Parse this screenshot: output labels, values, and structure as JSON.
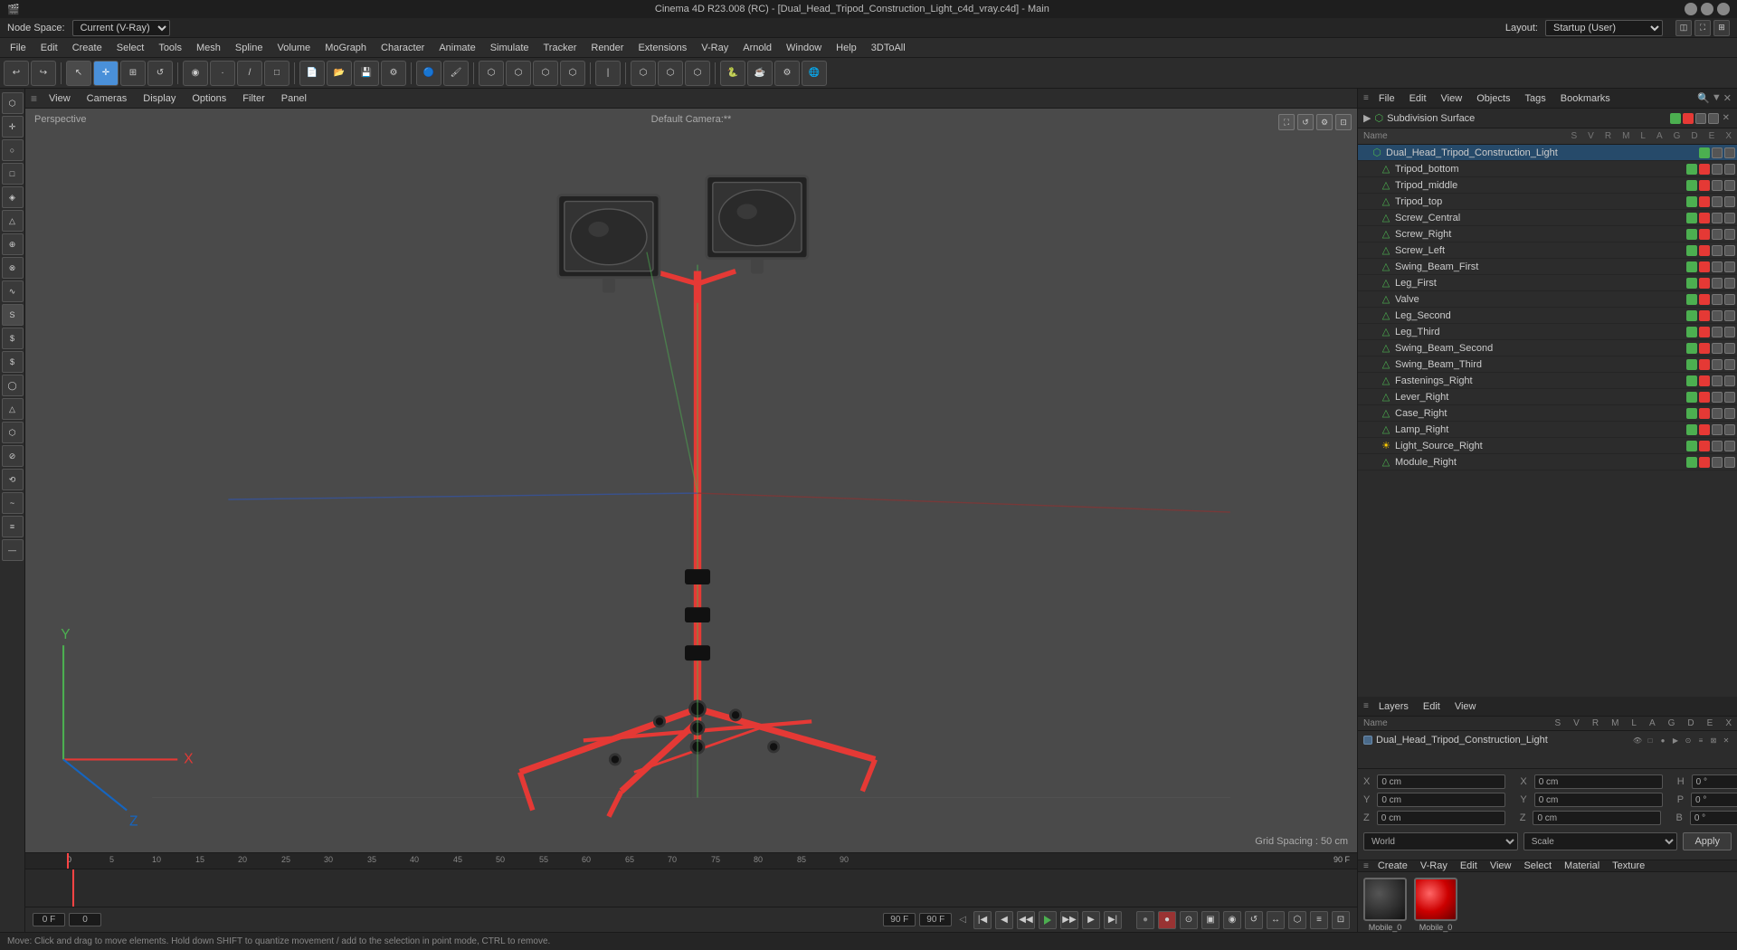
{
  "window": {
    "title": "Cinema 4D R23.008 (RC) - [Dual_Head_Tripod_Construction_Light_c4d_vray.c4d] - Main"
  },
  "menubar": {
    "items": [
      "File",
      "Edit",
      "Create",
      "Select",
      "Tools",
      "Mesh",
      "Spline",
      "Volume",
      "MoGraph",
      "Character",
      "Animate",
      "Simulate",
      "Tracker",
      "Render",
      "Extensions",
      "V-Ray",
      "Arnold",
      "Window",
      "Help",
      "3DToAll"
    ]
  },
  "toolbar": {
    "undo_label": "↩",
    "redo_label": "↪"
  },
  "nodespace": {
    "label": "Node Space:",
    "value": "Current (V-Ray)",
    "layout_label": "Layout:",
    "layout_value": "Startup (User)"
  },
  "viewport": {
    "label": "Perspective",
    "camera": "Default Camera:**",
    "grid_spacing": "Grid Spacing : 50 cm"
  },
  "object_manager": {
    "header_menus": [
      "File",
      "Edit",
      "View",
      "Objects",
      "Tags",
      "Bookmarks"
    ],
    "title_cols": {
      "name": "Name",
      "s": "S",
      "v": "V",
      "r": "R",
      "m": "M",
      "l": "L",
      "a": "A",
      "g": "G",
      "d": "D",
      "e": "E",
      "x": "X"
    },
    "subdivision_surface": "Subdivision Surface",
    "objects": [
      {
        "name": "Dual_Head_Tripod_Construction_Light",
        "indent": 1,
        "type": "group",
        "has_green": true,
        "has_red": false
      },
      {
        "name": "Tripod_bottom",
        "indent": 2,
        "type": "mesh",
        "has_green": true,
        "has_red": true
      },
      {
        "name": "Tripod_middle",
        "indent": 2,
        "type": "mesh",
        "has_green": true,
        "has_red": true
      },
      {
        "name": "Tripod_top",
        "indent": 2,
        "type": "mesh",
        "has_green": true,
        "has_red": true
      },
      {
        "name": "Screw_Central",
        "indent": 2,
        "type": "mesh",
        "has_green": true,
        "has_red": true
      },
      {
        "name": "Screw_Right",
        "indent": 2,
        "type": "mesh",
        "has_green": true,
        "has_red": true
      },
      {
        "name": "Screw_Left",
        "indent": 2,
        "type": "mesh",
        "has_green": true,
        "has_red": true
      },
      {
        "name": "Swing_Beam_First",
        "indent": 2,
        "type": "mesh",
        "has_green": true,
        "has_red": true
      },
      {
        "name": "Leg_First",
        "indent": 2,
        "type": "mesh",
        "has_green": true,
        "has_red": true
      },
      {
        "name": "Valve",
        "indent": 2,
        "type": "mesh",
        "has_green": true,
        "has_red": true
      },
      {
        "name": "Leg_Second",
        "indent": 2,
        "type": "mesh",
        "has_green": true,
        "has_red": true
      },
      {
        "name": "Leg_Third",
        "indent": 2,
        "type": "mesh",
        "has_green": true,
        "has_red": true
      },
      {
        "name": "Swing_Beam_Second",
        "indent": 2,
        "type": "mesh",
        "has_green": true,
        "has_red": true
      },
      {
        "name": "Swing_Beam_Third",
        "indent": 2,
        "type": "mesh",
        "has_green": true,
        "has_red": true
      },
      {
        "name": "Fastenings_Right",
        "indent": 2,
        "type": "mesh",
        "has_green": true,
        "has_red": true
      },
      {
        "name": "Lever_Right",
        "indent": 2,
        "type": "mesh",
        "has_green": true,
        "has_red": true
      },
      {
        "name": "Case_Right",
        "indent": 2,
        "type": "mesh",
        "has_green": true,
        "has_red": true
      },
      {
        "name": "Lamp_Right",
        "indent": 2,
        "type": "mesh",
        "has_green": true,
        "has_red": true
      },
      {
        "name": "Light_Source_Right",
        "indent": 2,
        "type": "light",
        "has_green": true,
        "has_red": true
      },
      {
        "name": "Module_Right",
        "indent": 2,
        "type": "mesh",
        "has_green": true,
        "has_red": true
      }
    ]
  },
  "layers": {
    "header_menus": [
      "Layers",
      "Edit",
      "View"
    ],
    "cols": {
      "name": "Name",
      "s": "S",
      "v": "V",
      "r": "R",
      "m": "M",
      "l": "L",
      "a": "A",
      "g": "G",
      "d": "D",
      "e": "E",
      "x": "X"
    },
    "items": [
      {
        "name": "Dual_Head_Tripod_Construction_Light",
        "color": "#4a6a8a"
      }
    ]
  },
  "coordinates": {
    "x_pos": "0 cm",
    "y_pos": "0 cm",
    "z_pos": "0 cm",
    "x_rot": "0 °",
    "y_rot": "0 °",
    "z_rot": "0 °",
    "h_val": "0 °",
    "p_val": "0 °",
    "b_val": "0 °",
    "world_label": "World",
    "scale_label": "Scale",
    "apply_label": "Apply"
  },
  "timeline": {
    "frame_start": "0 F",
    "frame_current": "0 F",
    "frame_input": "0",
    "frame_end": "90 F",
    "frame_end2": "90 F",
    "frame_end3": "90 F",
    "marks": [
      "0",
      "5",
      "10",
      "15",
      "20",
      "25",
      "30",
      "35",
      "40",
      "45",
      "50",
      "55",
      "60",
      "65",
      "70",
      "75",
      "80",
      "85",
      "90"
    ],
    "current_frame_display": "0 F"
  },
  "materials": [
    {
      "name": "Mobile_0",
      "type": "sphere",
      "color": "#2a2a2a"
    },
    {
      "name": "Mobile_0",
      "type": "sphere",
      "color": "#cc3333"
    }
  ],
  "material_bar": {
    "menus": [
      "Create",
      "V-Ray",
      "Edit",
      "View",
      "Select",
      "Material",
      "Texture"
    ]
  },
  "statusbar": {
    "message": "Move: Click and drag to move elements. Hold down SHIFT to quantize movement / add to the selection in point mode, CTRL to remove."
  },
  "left_tools": [
    "▶",
    "✛",
    "○",
    "□",
    "◇",
    "△",
    "⊕",
    "⊗",
    "∿",
    "S",
    "S",
    "S",
    "◯",
    "△",
    "⬡",
    "⊘",
    "⟲",
    "~",
    "≡",
    "—"
  ]
}
